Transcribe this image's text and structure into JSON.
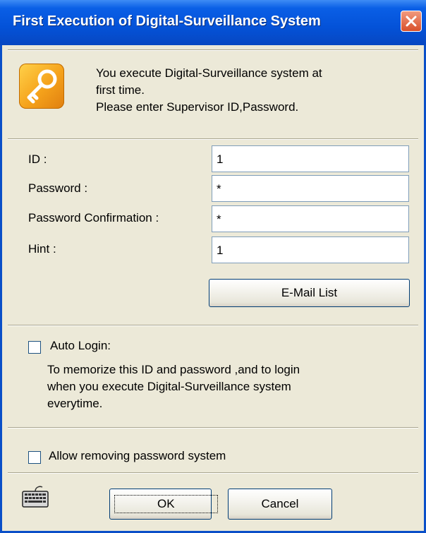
{
  "window": {
    "title": "First Execution of Digital-Surveillance System",
    "close_icon": "close-icon"
  },
  "message": {
    "icon": "key-icon",
    "lines": [
      "You execute Digital-Surveillance system at",
      "first time.",
      "Please enter Supervisor ID,Password."
    ]
  },
  "form": {
    "id_label": "ID :",
    "id_value": "1",
    "password_label": "Password :",
    "password_value": "*",
    "confirm_label": "Password Confirmation :",
    "confirm_value": "*",
    "hint_label": "Hint :",
    "hint_value": "1",
    "email_button": "E-Mail List"
  },
  "auto_login": {
    "label": "Auto Login:",
    "checked": false,
    "description": [
      "To memorize this ID and password ,and to login",
      "when you execute Digital-Surveillance system",
      "everytime."
    ]
  },
  "remove_password": {
    "label": "Allow removing password system",
    "checked": false
  },
  "footer": {
    "keyboard_icon": "keyboard-icon",
    "ok_label": "OK",
    "cancel_label": "Cancel"
  },
  "colors": {
    "titlebar": "#0452D8",
    "close": "#D8502B",
    "face": "#ECE9D8",
    "icon": "#F5A21B"
  }
}
